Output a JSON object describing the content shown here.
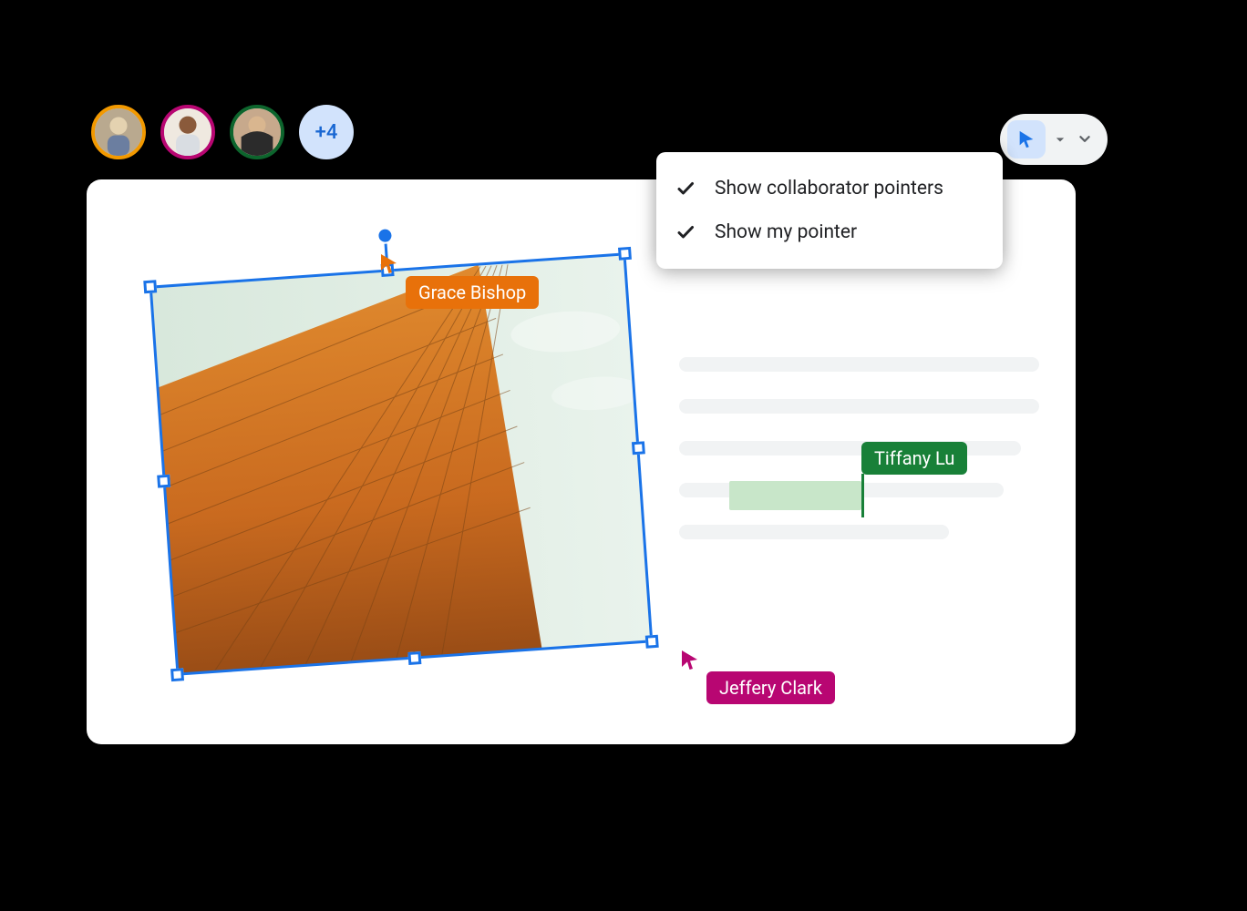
{
  "avatars": {
    "more_count": "+4",
    "ring_colors": [
      "#f29900",
      "#b80672",
      "#0d652d"
    ]
  },
  "pointer_tool": {
    "active_icon": "cursor-icon"
  },
  "dropdown": {
    "items": [
      {
        "label": "Show collaborator pointers",
        "checked": true
      },
      {
        "label": "Show my pointer",
        "checked": true
      }
    ]
  },
  "collaborators": {
    "grace": {
      "name": "Grace Bishop",
      "color": "#e8710a"
    },
    "tiffany": {
      "name": "Tiffany Lu",
      "color": "#188038"
    },
    "jeffery": {
      "name": "Jeffery Clark",
      "color": "#b80672"
    }
  },
  "image": {
    "description": "Low-angle photo of a glass office building with warm orange tint",
    "selected": true,
    "rotation_deg": -4
  }
}
